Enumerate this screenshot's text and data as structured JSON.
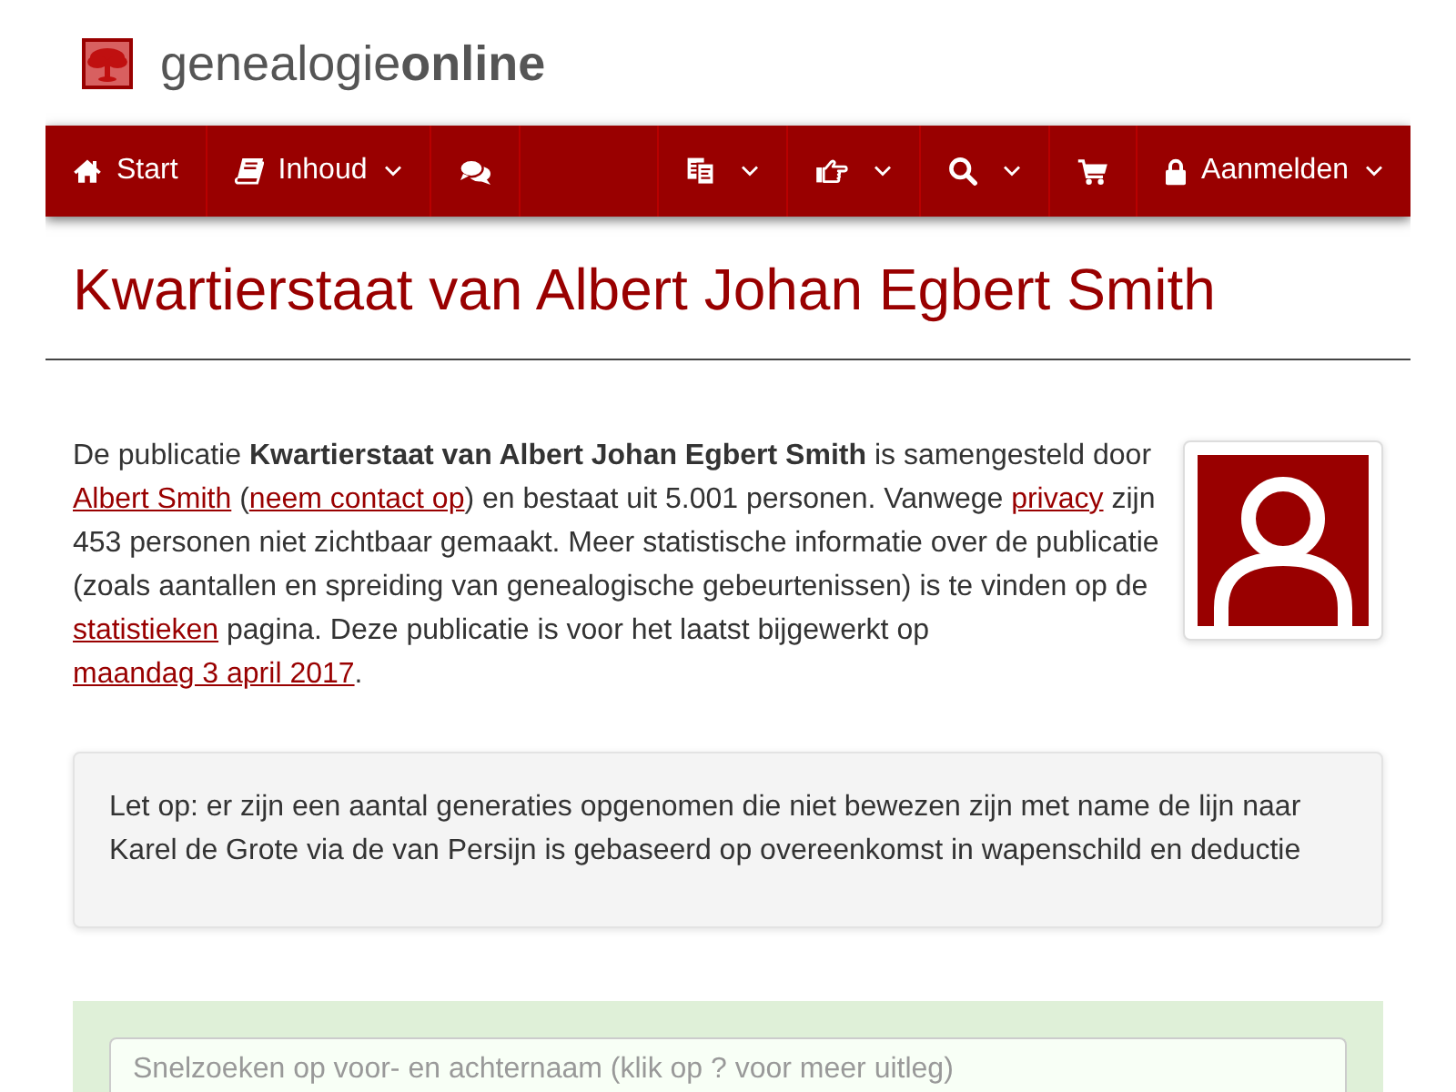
{
  "logo": {
    "text": "genealogie**online**"
  },
  "nav": {
    "left": [
      {
        "label": "Start",
        "dropdown": false
      },
      {
        "label": "Inhoud",
        "dropdown": true
      },
      {
        "dropdown": false
      }
    ],
    "right": [
      {
        "dropdown": true
      },
      {
        "dropdown": true
      },
      {
        "dropdown": true
      },
      {
        "dropdown": false
      },
      {
        "label": "Aanmelden",
        "dropdown": true
      }
    ]
  },
  "title": "Kwartierstaat van Albert Johan Egbert Smith",
  "intro": [
    {
      "kind": "text",
      "text": "De publicatie **Kwartierstaat van Albert Johan Egbert Smith** is samengesteld door "
    },
    {
      "kind": "link",
      "text": "Albert Smith"
    },
    {
      "kind": "text",
      "text": " ("
    },
    {
      "kind": "link",
      "text": "neem contact op"
    },
    {
      "kind": "text",
      "text": ") en bestaat uit 5.001 personen. Vanwege "
    },
    {
      "kind": "link",
      "text": "privacy"
    },
    {
      "kind": "text",
      "text": " zijn 453 personen niet zichtbaar gemaakt. Meer statistische informatie over de publicatie (zoals aantallen en spreiding van genealogische gebeurtenissen) is te vinden op de "
    },
    {
      "kind": "link",
      "text": "statistieken"
    },
    {
      "kind": "text",
      "text": " pagina. Deze publicatie is voor het laatst bijgewerkt op "
    },
    {
      "kind": "link",
      "text": "maandag 3 april 2017"
    },
    {
      "kind": "text",
      "text": "."
    }
  ],
  "note": {
    "text": "Let op: er zijn een aantal generaties opgenomen die niet bewezen zijn met name de lijn naar Karel de Grote via de van Persijn is gebaseerd op overeenkomst in wapenschild en deductie"
  },
  "quick_search": {
    "placeholder": "Snelzoeken op voor- en achternaam (klik op ? voor meer uitleg)"
  }
}
